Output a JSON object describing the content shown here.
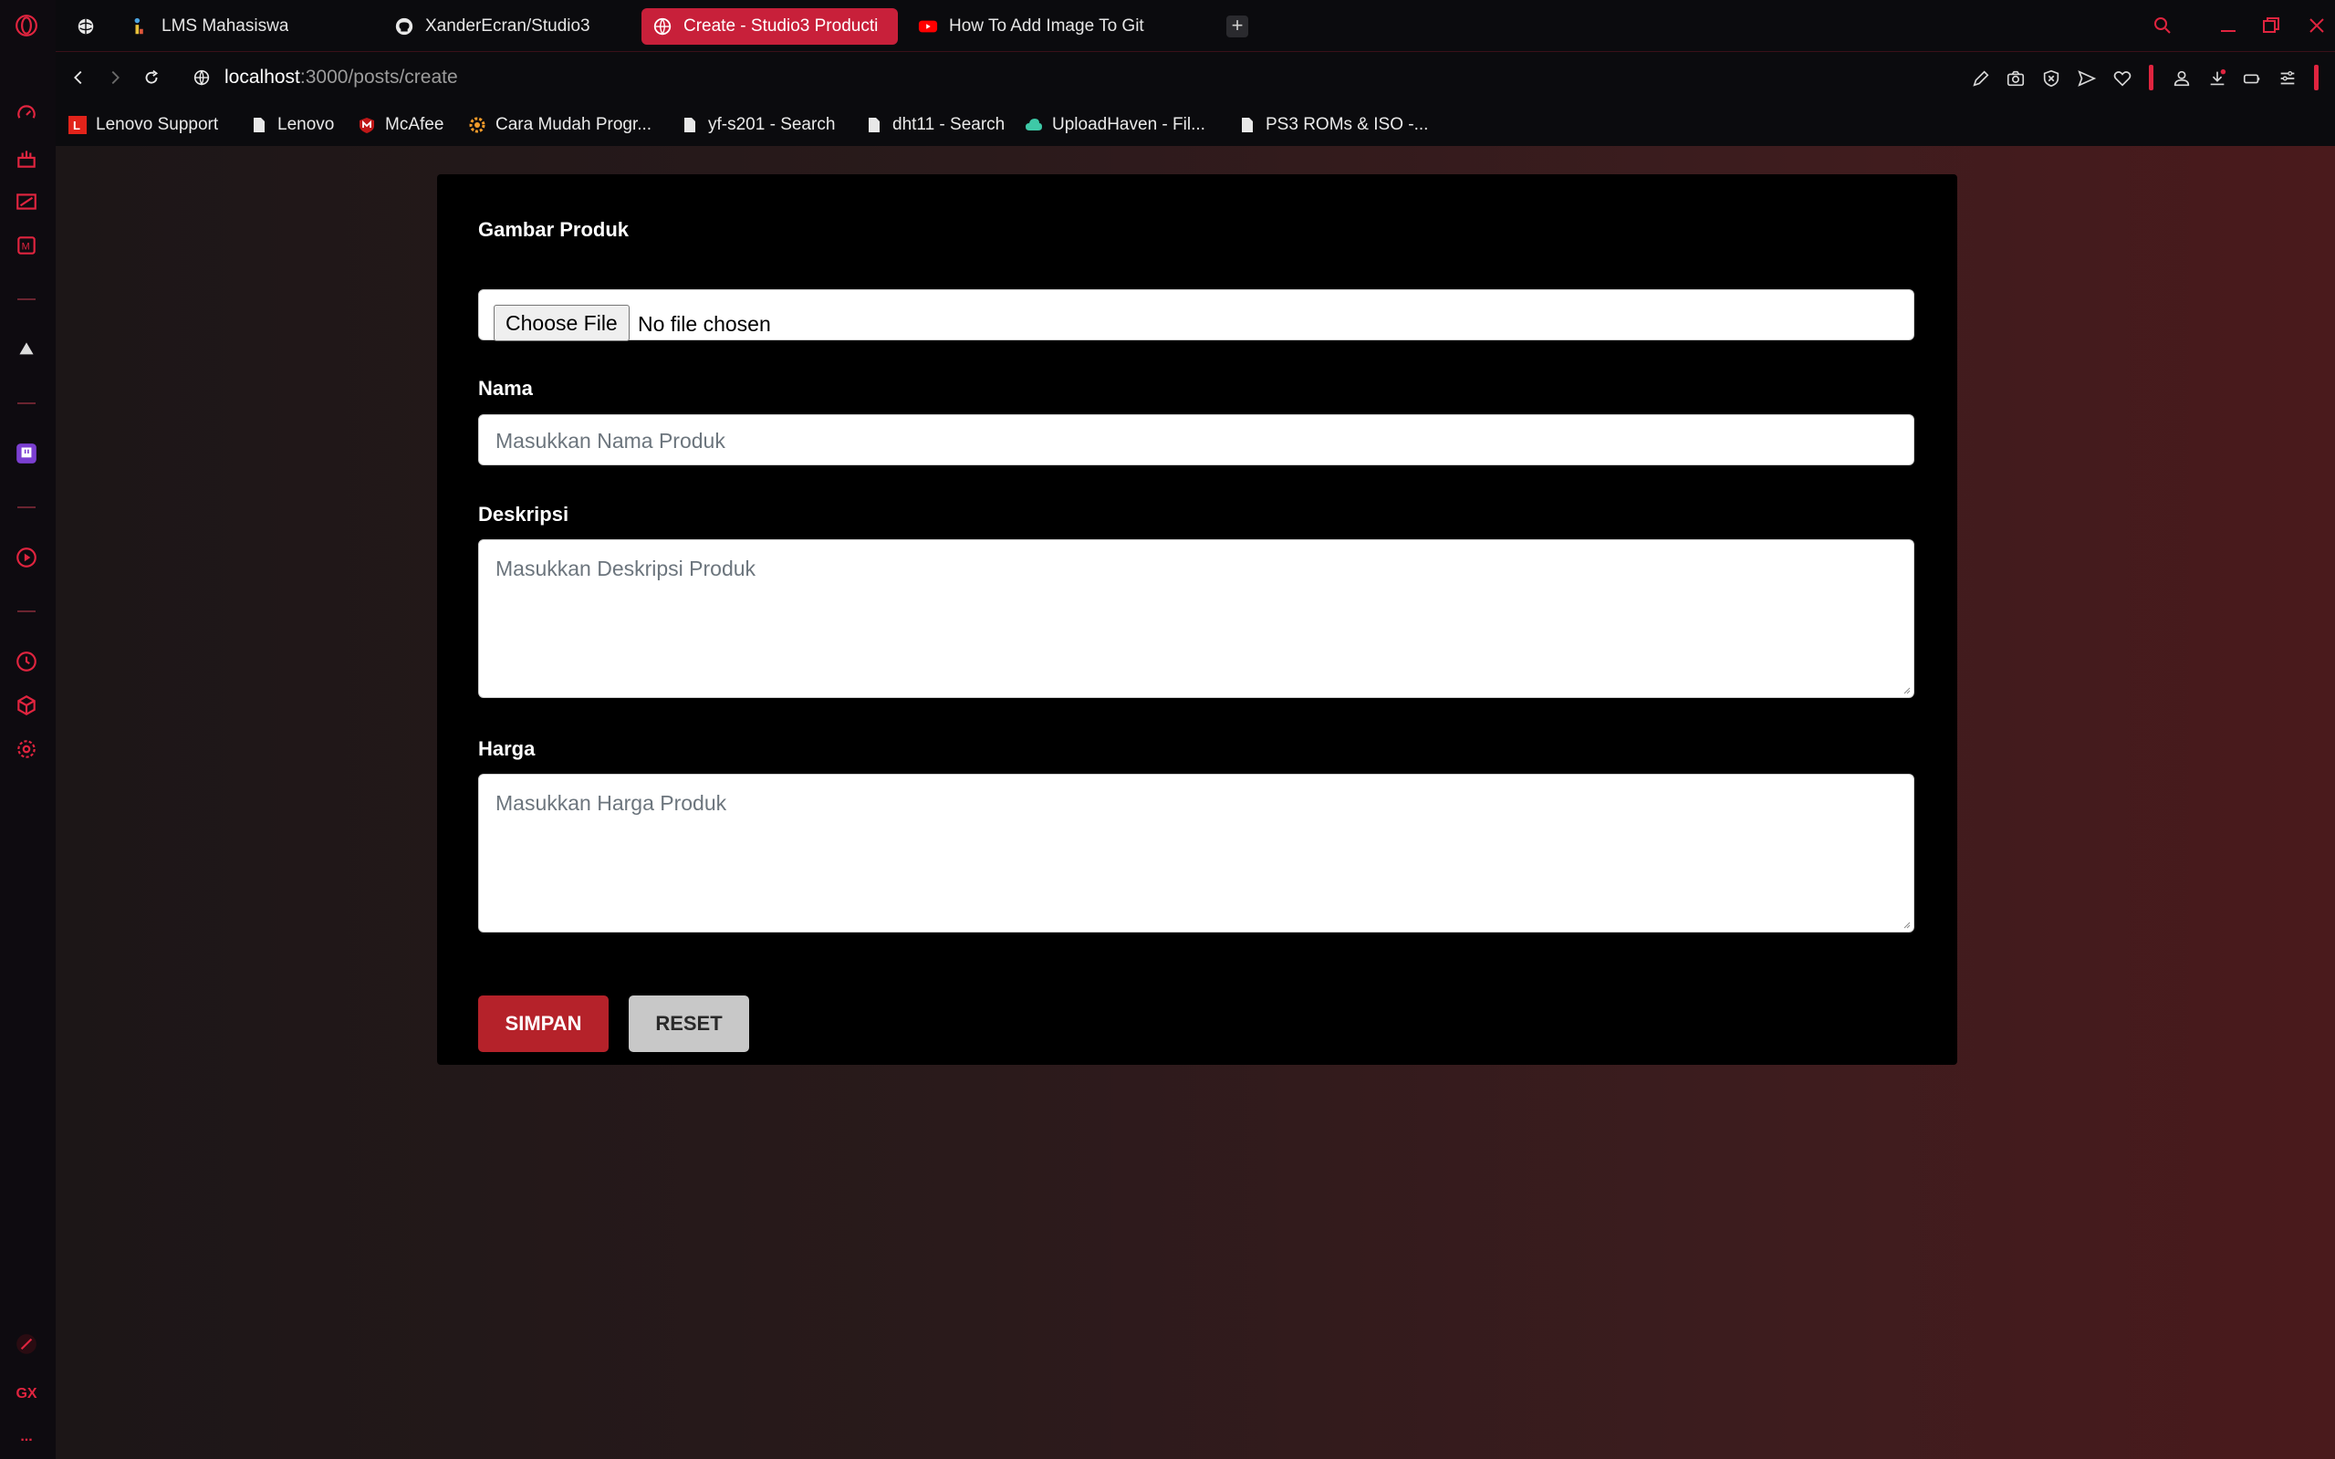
{
  "browser": {
    "tabs": [
      {
        "label": "",
        "icon": "globe-icon"
      },
      {
        "label": "LMS Mahasiswa",
        "icon": "lms-icon"
      },
      {
        "label": "XanderEcran/Studio3",
        "icon": "github-icon"
      },
      {
        "label": "Create - Studio3 Producti",
        "icon": "globe-icon",
        "active": true
      },
      {
        "label": "How To Add Image To Git",
        "icon": "youtube-icon"
      }
    ],
    "new_tab_label": "+",
    "address": {
      "host": "localhost",
      "path": ":3000/posts/create"
    },
    "bookmarks": [
      {
        "label": "Lenovo Support",
        "icon": "lenovo-icon"
      },
      {
        "label": "Lenovo",
        "icon": "page-icon"
      },
      {
        "label": "McAfee",
        "icon": "mcafee-icon"
      },
      {
        "label": "Cara Mudah Progr...",
        "icon": "gear-icon"
      },
      {
        "label": "yf-s201 - Search",
        "icon": "page-icon"
      },
      {
        "label": "dht11 - Search",
        "icon": "page-icon"
      },
      {
        "label": "UploadHaven - Fil...",
        "icon": "cloud-icon"
      },
      {
        "label": "PS3 ROMs & ISO -...",
        "icon": "page-icon"
      }
    ],
    "sidebar_gx_label": "GX",
    "sidebar_more_label": "...",
    "accent_color": "#e0243f"
  },
  "form": {
    "image_label": "Gambar Produk",
    "file_button_label": "Choose File",
    "file_status": "No file chosen",
    "name_label": "Nama",
    "name_placeholder": "Masukkan Nama Produk",
    "description_label": "Deskripsi",
    "description_placeholder": "Masukkan Deskripsi Produk",
    "price_label": "Harga",
    "price_placeholder": "Masukkan Harga Produk",
    "save_label": "SIMPAN",
    "reset_label": "RESET",
    "save_color": "#b5222a",
    "reset_color": "#c8c8c8"
  }
}
